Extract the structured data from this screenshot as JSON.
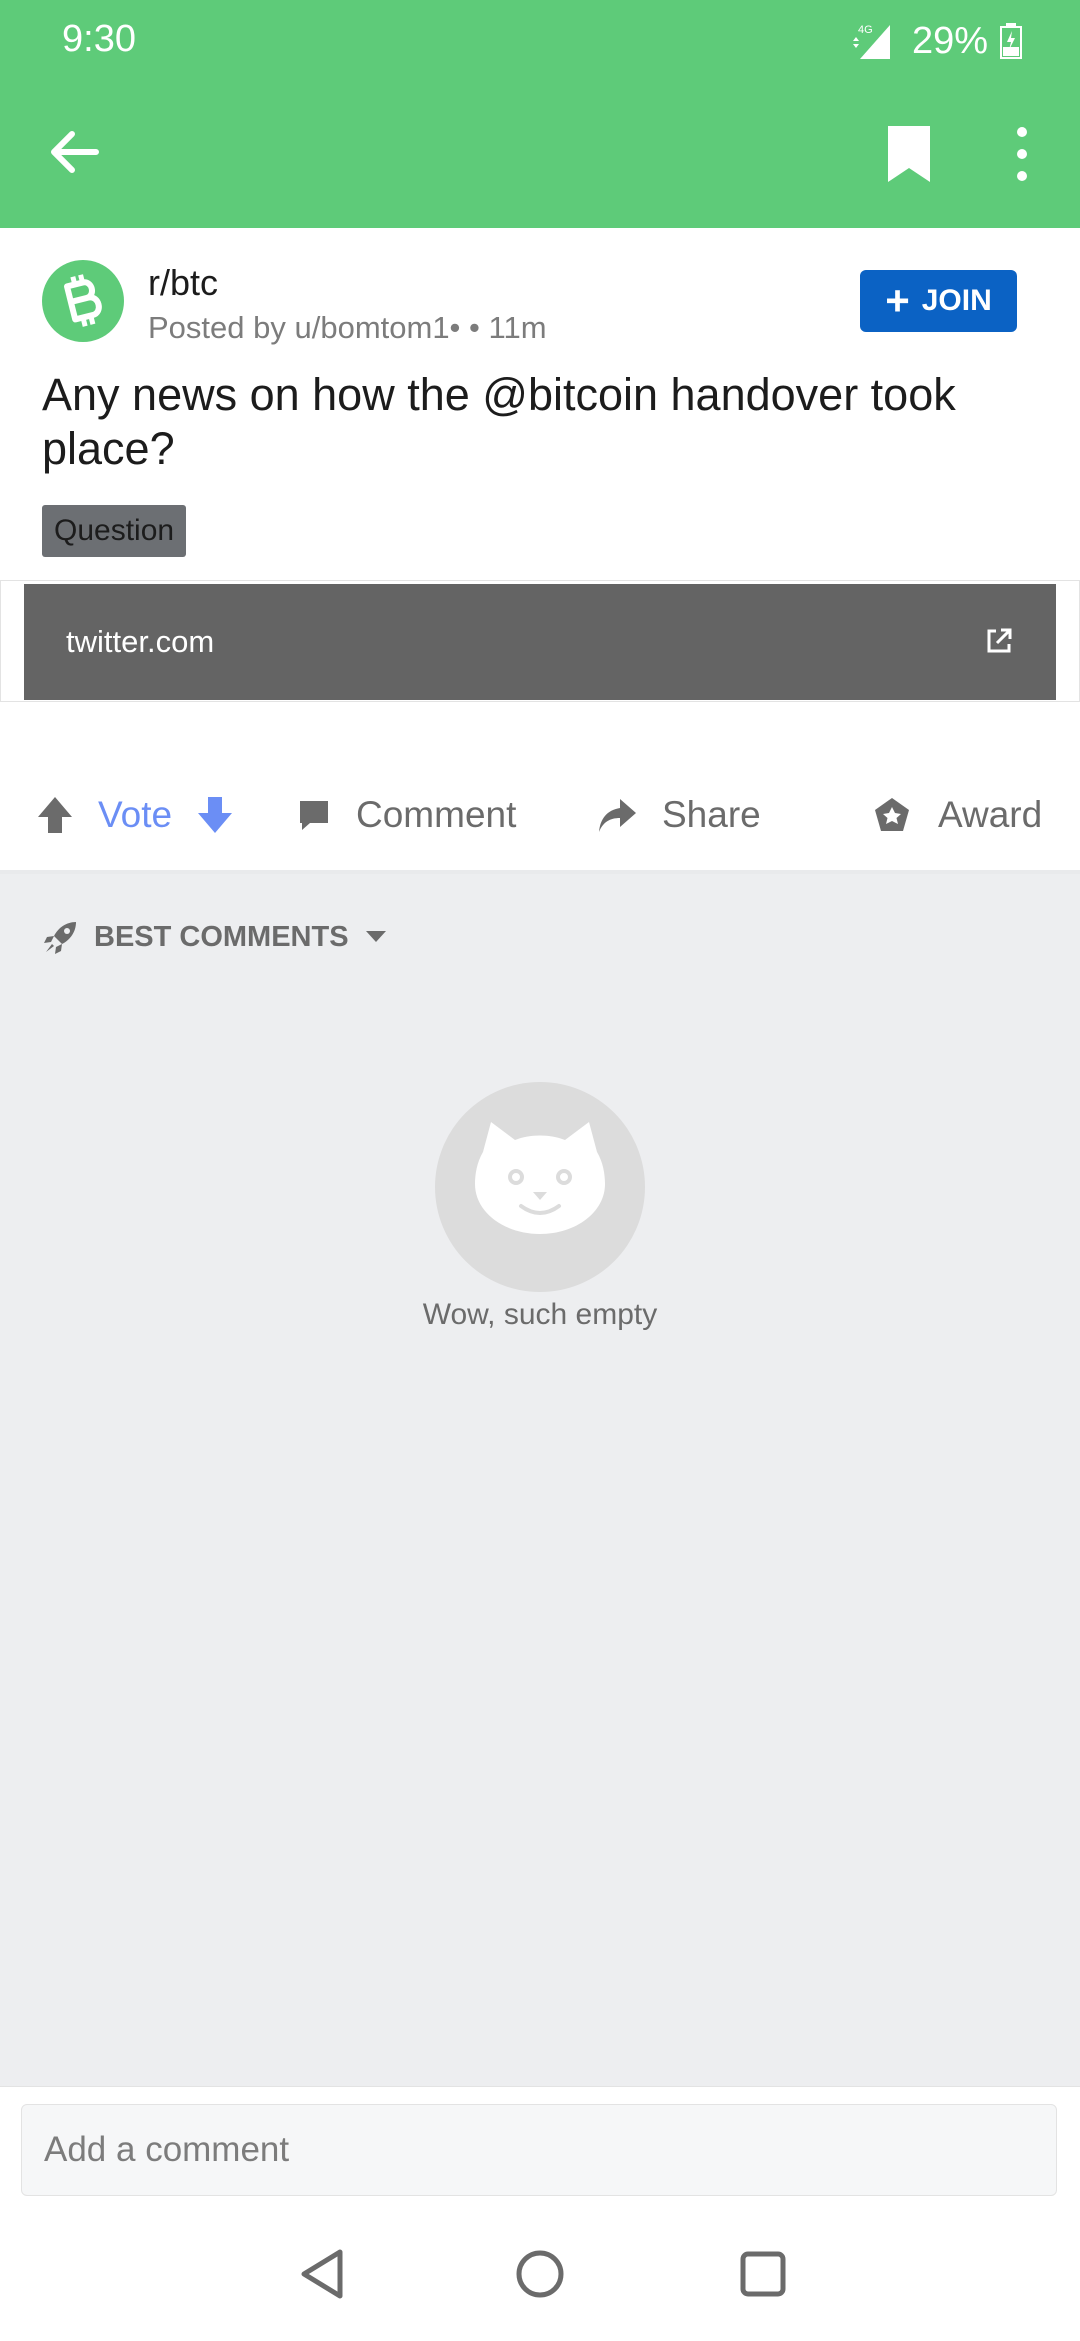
{
  "status_bar": {
    "time": "9:30",
    "network": "4G",
    "battery": "29%"
  },
  "app_bar": {
    "back_icon": "arrow-left-icon",
    "bookmark_icon": "bookmark-icon",
    "more_icon": "more-vertical-icon"
  },
  "post": {
    "subreddit": "r/btc",
    "posted_by": "Posted by u/bomtom1•",
    "age": "• 11m",
    "join_label": "JOIN",
    "title": "Any news on how the @bitcoin handover took place?",
    "flair": "Question",
    "link_domain": "twitter.com"
  },
  "actions": {
    "vote": "Vote",
    "comment": "Comment",
    "share": "Share",
    "award": "Award"
  },
  "comments": {
    "sort_label": "BEST COMMENTS",
    "empty_text": "Wow, such empty"
  },
  "comment_box": {
    "placeholder": "Add a comment"
  },
  "colors": {
    "app_bar": "#5ecb79",
    "join_button": "#0b62c4",
    "vote_accent": "#6b8ef5"
  }
}
